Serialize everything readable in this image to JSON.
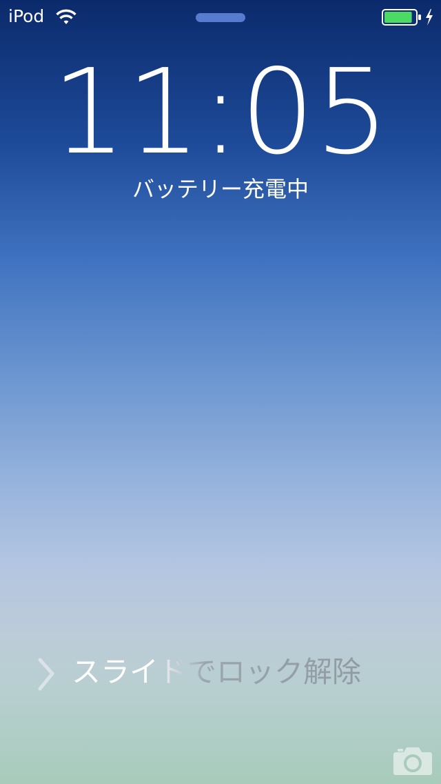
{
  "status_bar": {
    "carrier": "iPod",
    "wifi_icon": "wifi-icon",
    "battery_icon": "battery-charging-icon",
    "battery_level": 0.9,
    "battery_color": "#4cd964",
    "bolt_icon": "charging-bolt-icon"
  },
  "lock_screen": {
    "time_hour": "11",
    "time_separator": ":",
    "time_minute": "05",
    "status": "バッテリー充電中",
    "slide_to_unlock": "スライドでロック解除",
    "slide_icon": "chevron-right-icon",
    "camera_icon": "camera-icon"
  }
}
